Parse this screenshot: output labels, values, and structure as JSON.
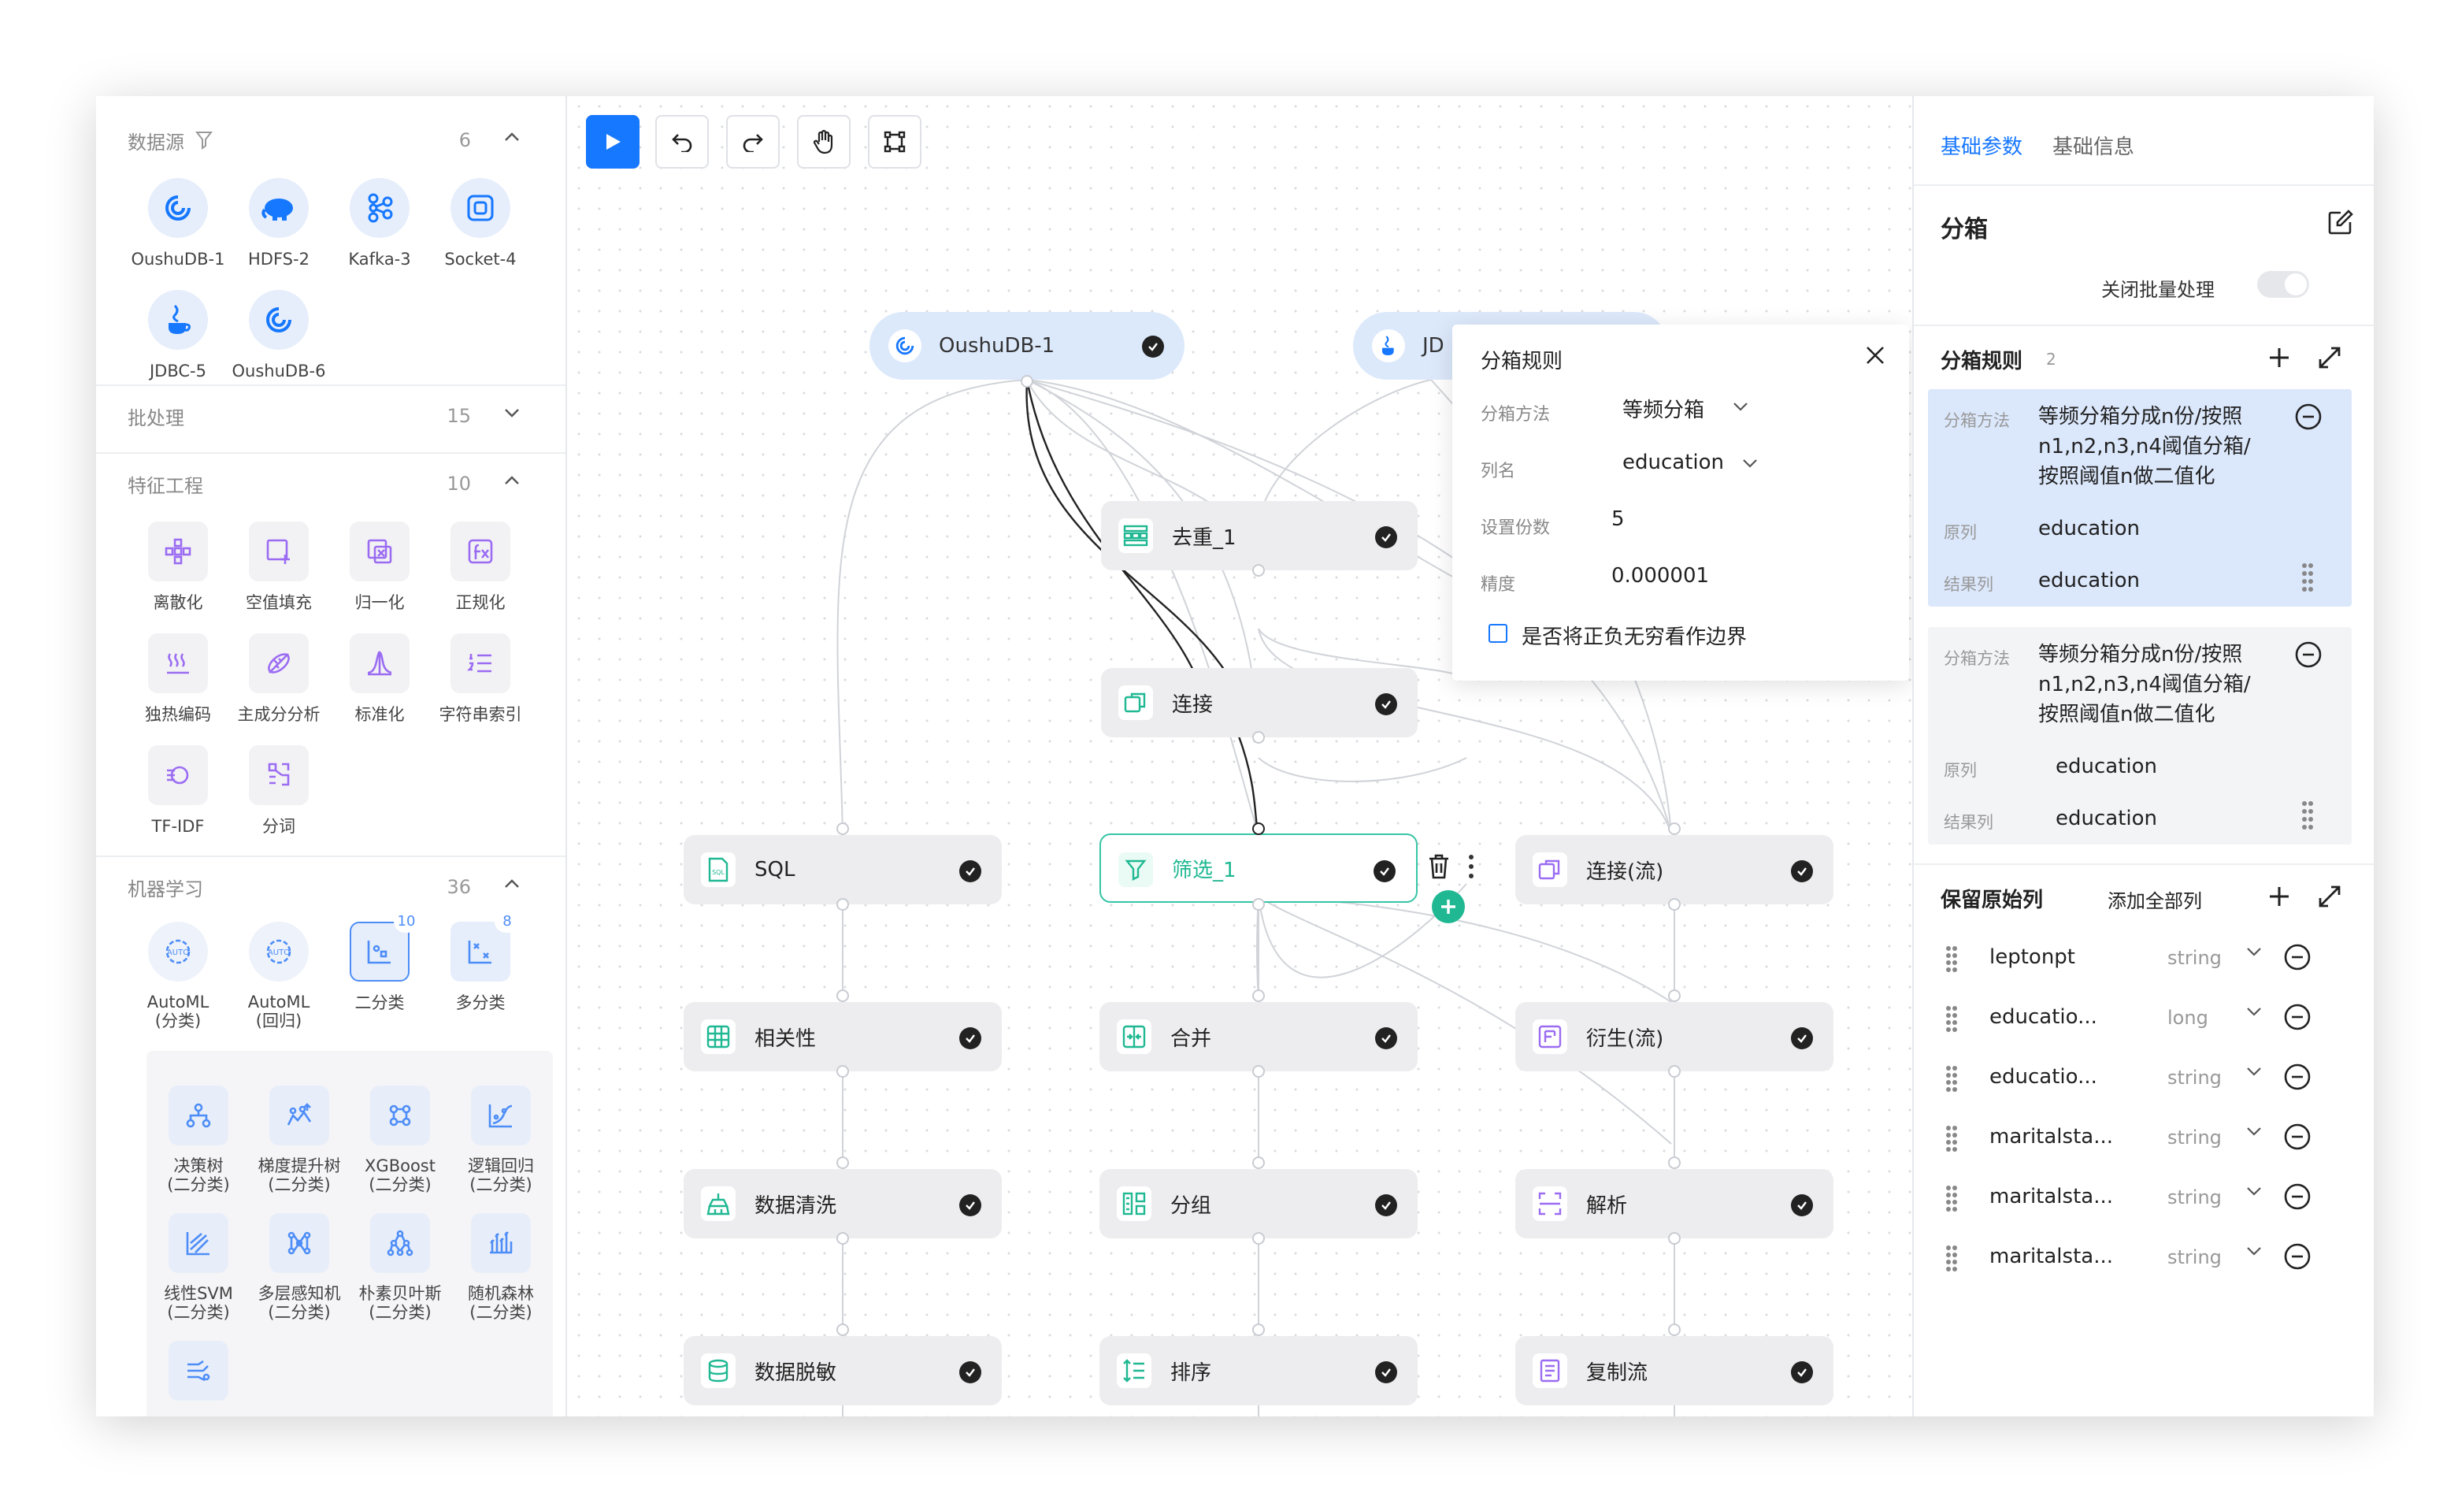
{
  "left_panel": {
    "data_sources": {
      "title": "数据源",
      "count": "6",
      "items": [
        "OushuDB-1",
        "HDFS-2",
        "Kafka-3",
        "Socket-4",
        "JDBC-5",
        "OushuDB-6"
      ]
    },
    "batch": {
      "title": "批处理",
      "count": "15"
    },
    "feature_engineering": {
      "title": "特征工程",
      "count": "10",
      "items": [
        "离散化",
        "空值填充",
        "归一化",
        "正规化",
        "独热编码",
        "主成分分析",
        "标准化",
        "字符串索引",
        "TF-IDF",
        "分词"
      ]
    },
    "machine_learning": {
      "title": "机器学习",
      "count": "36",
      "items": [
        {
          "label": "AutoML\n(分类)"
        },
        {
          "label": "AutoML\n(回归)"
        },
        {
          "label": "二分类",
          "badge": "10"
        },
        {
          "label": "多分类",
          "badge": "8"
        }
      ],
      "sub_items": [
        "决策树\n(二分类)",
        "梯度提升树\n(二分类)",
        "XGBoost\n(二分类)",
        "逻辑回归\n(二分类)",
        "线性SVM\n(二分类)",
        "多层感知机\n(二分类)",
        "朴素贝叶斯\n(二分类)",
        "随机森林\n(二分类)",
        ""
      ]
    }
  },
  "canvas": {
    "source_nodes": [
      "OushuDB-1",
      "JD"
    ],
    "nodes": {
      "dedup": "去重_1",
      "join": "连接",
      "sql": "SQL",
      "filter": "筛选_1",
      "stream_join": "连接(流)",
      "correlation": "相关性",
      "merge": "合并",
      "derive_stream": "衍生(流)",
      "cleaning": "数据清洗",
      "group": "分组",
      "parse": "解析",
      "masking": "数据脱敏",
      "sort": "排序",
      "copy_stream": "复制流"
    }
  },
  "popup": {
    "title": "分箱规则",
    "method_label": "分箱方法",
    "method_value": "等频分箱",
    "column_label": "列名",
    "column_value": "education",
    "parts_label": "设置份数",
    "parts_value": "5",
    "precision_label": "精度",
    "precision_value": "0.000001",
    "checkbox_label": "是否将正负无穷看作边界"
  },
  "right_panel": {
    "tab_active": "基础参数",
    "tab_inactive": "基础信息",
    "title": "分箱",
    "batch_toggle_label": "关闭批量处理",
    "rules_title": "分箱规则",
    "rules_count": "2",
    "rules": [
      {
        "k1": "分箱方法",
        "v1": "等频分箱分成n份/按照n1,n2,n3,n4阈值分箱/按照阈值n做二值化",
        "k2": "原列",
        "v2": "education",
        "k3": "结果列",
        "v3": "education"
      },
      {
        "k1": "分箱方法",
        "v1": "等频分箱分成n份/按照n1,n2,n3,n4阈值分箱/按照阈值n做二值化",
        "k2": "原列",
        "v2": "education",
        "k3": "结果列",
        "v3": "education"
      }
    ],
    "keep_title": "保留原始列",
    "add_all_label": "添加全部列",
    "columns": [
      {
        "name": "leptonpt",
        "type": "string"
      },
      {
        "name": "educatio...",
        "type": "long"
      },
      {
        "name": "educatio...",
        "type": "string"
      },
      {
        "name": "maritalsta...",
        "type": "string"
      },
      {
        "name": "maritalsta...",
        "type": "string"
      },
      {
        "name": "maritalsta...",
        "type": "string"
      }
    ]
  },
  "colors": {
    "accent": "#1677ff",
    "selected_node_border": "#37c5a6",
    "icon_green": "#1fb892",
    "icon_purple": "#9b6cf2",
    "rule_highlight": "#dbe7fb"
  }
}
